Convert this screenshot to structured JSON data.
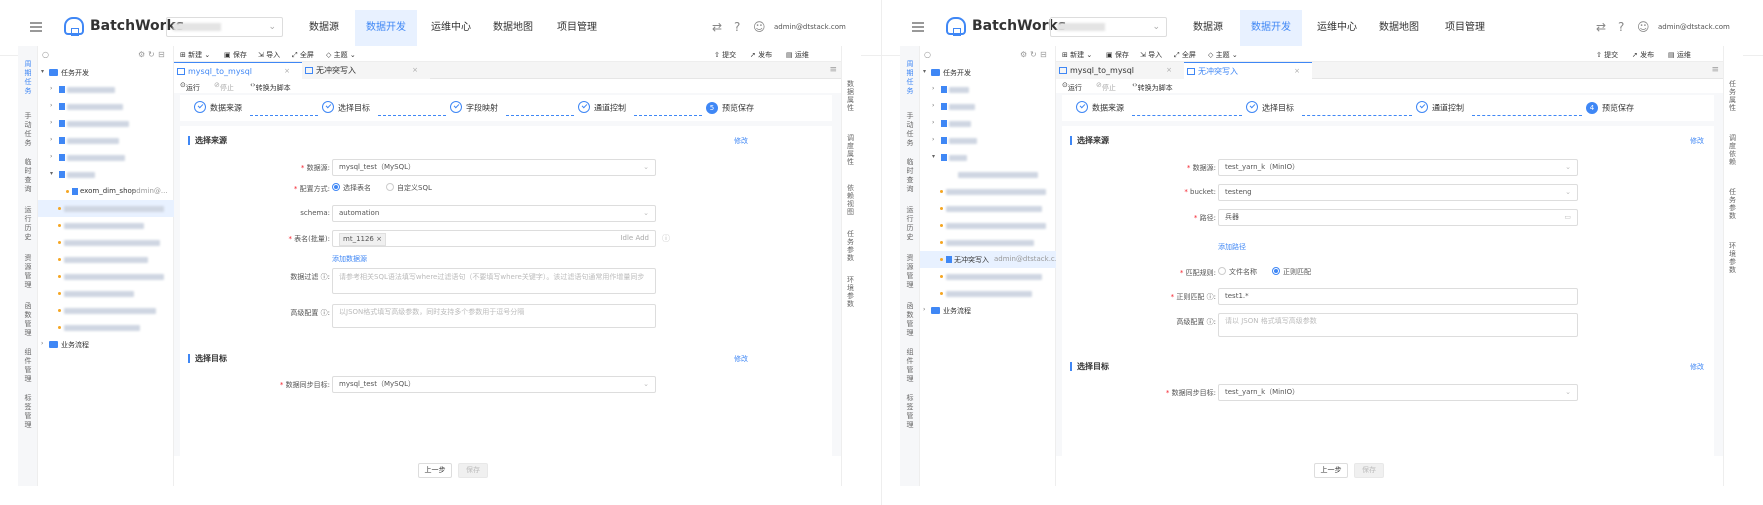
{
  "app": {
    "brand": "BatchWorks",
    "user": "admin@dtstack.com"
  },
  "nav": [
    "数据源",
    "数据开发",
    "运维中心",
    "数据地图",
    "项目管理"
  ],
  "sidebar_items": [
    "周期任务",
    "手动任务",
    "临时查询",
    "运行历史",
    "资源管理",
    "函数管理",
    "组件管理",
    "标签管理"
  ],
  "right_panel_left": [
    "数据属性",
    "调度属性",
    "依赖视图",
    "任务参数",
    "环境参数"
  ],
  "right_panel_right": [
    "任务属性",
    "调度依赖",
    "任务参数",
    "环境参数"
  ],
  "tree": {
    "root": "任务开发",
    "leaf_left": "exom_dim_shop",
    "leaf_left_owner": "admin@...",
    "leaf_right": "无冲突写入",
    "leaf_right_owner": "admin@dtstack.c...",
    "biz": "业务流程"
  },
  "toolbar": {
    "new": "新建",
    "save": "保存",
    "import": "导入",
    "format": "全屏",
    "theme": "主题",
    "submit": "提交",
    "publish": "发布",
    "ops": "运维"
  },
  "tabs": {
    "t1": "mysql_to_mysql",
    "t2": "无冲突写入"
  },
  "runbar": {
    "run": "运行",
    "stop": "停止",
    "convert": "转换为脚本"
  },
  "left": {
    "steps": [
      "数据来源",
      "选择目标",
      "字段映射",
      "通道控制",
      "预览保存"
    ],
    "last_step_num": "5",
    "section1": "选择来源",
    "section2": "选择目标",
    "edit": "修改",
    "f_datasource_label": "数据源",
    "f_datasource": "mysql_test（MySQL）",
    "f_mode_label": "配置方式",
    "f_mode_opt1": "选择表名",
    "f_mode_opt2": "自定义SQL",
    "f_schema_label": "schema",
    "f_schema": "automation",
    "f_table_label": "表名(批量)",
    "f_table_tag": "mt_1126 ×",
    "f_table_hint": "Idle Add",
    "add_table": "添加数据源",
    "f_filter_label": "数据过滤",
    "f_filter_ph": "请参考相关SQL语法填写where过滤语句（不要填写where关键字）。该过滤语句通常用作增量同步",
    "f_adv_label": "高级配置",
    "f_adv_ph": "以JSON格式填写高级参数，同时支持多个参数用于逗号分隔",
    "f_target_label": "数据同步目标",
    "f_target": "mysql_test（MySQL）"
  },
  "right": {
    "steps": [
      "数据来源",
      "选择目标",
      "通道控制",
      "预览保存"
    ],
    "last_step_num": "4",
    "section1": "选择来源",
    "section2": "选择目标",
    "edit": "修改",
    "f_datasource_label": "数据源",
    "f_datasource": "test_yarn_k（MinIO）",
    "f_bucket_label": "bucket",
    "f_bucket": "testeng",
    "f_path_label": "路径",
    "f_path": "兵器",
    "add_path": "添加路径",
    "f_match_label": "匹配规则",
    "f_match_opt1": "文件名称",
    "f_match_opt2": "正则匹配",
    "f_regex_label": "正则匹配",
    "f_regex": "test1.*",
    "f_adv_label": "高级配置",
    "f_adv_ph": "请以 JSON 格式填写高级参数",
    "f_target_label": "数据同步目标",
    "f_target": "test_yarn_k（MinIO）"
  },
  "buttons": {
    "prev": "上一步",
    "next": "保存"
  },
  "colors": {
    "accent": "#3f87f5",
    "required": "#f5222d"
  }
}
